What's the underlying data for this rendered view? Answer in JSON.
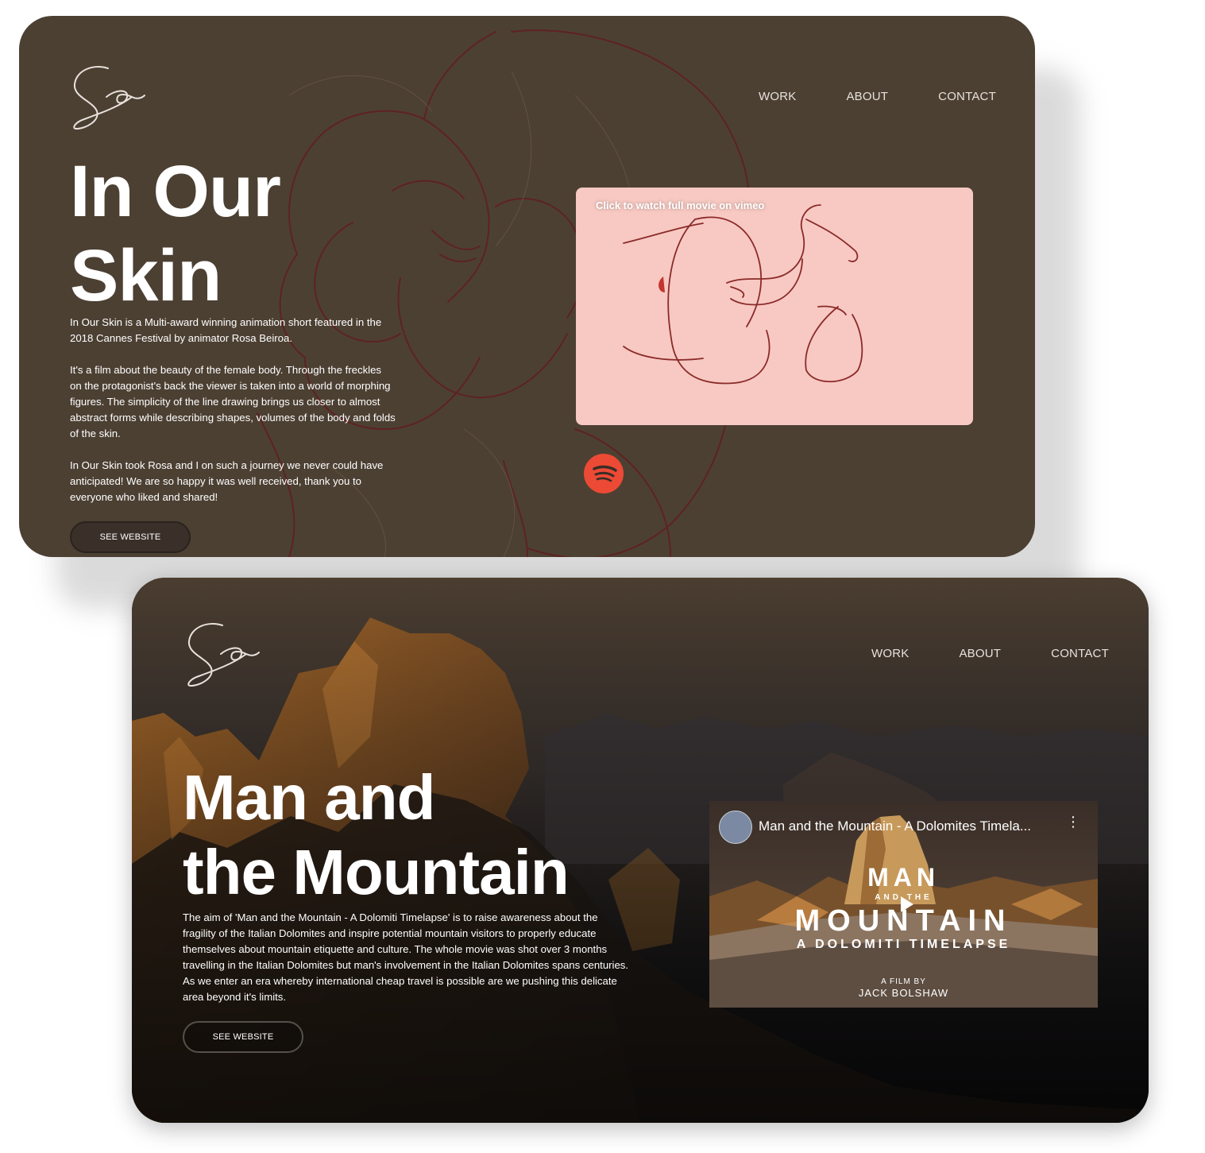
{
  "nav": {
    "work": "WORK",
    "about": "ABOUT",
    "contact": "CONTACT"
  },
  "project1": {
    "title_line1": "In Our",
    "title_line2": "Skin",
    "paragraphs": [
      "In Our Skin is a Multi-award winning animation short featured in the 2018 Cannes Festival by animator Rosa Beiroa.",
      "It's a film about the beauty of the female body. Through the freckles on the protagonist's back the viewer is taken into a world of morphing figures. The simplicity of the line drawing brings us closer to almost abstract forms while describing shapes, volumes of the body and folds of the skin.",
      "In Our Skin took Rosa and I on such a journey we never could have anticipated! We are so happy it was well received, thank you to everyone who liked and shared!"
    ],
    "button": "SEE WEBSITE",
    "video_caption": "Click to watch full movie on vimeo"
  },
  "project2": {
    "title_line1": "Man and",
    "title_line2": "the Mountain",
    "paragraph": "The aim of 'Man and the Mountain - A Dolomiti Timelapse' is to raise awareness about the fragility of the Italian Dolomites and inspire potential mountain visitors to properly educate themselves about mountain etiquette and culture. The whole movie was shot over 3 months travelling in the Italian Dolomites but man's involvement in the Italian Dolomites spans centuries. As we enter an era whereby international cheap travel is possible are we pushing this delicate area beyond it's limits.",
    "button": "SEE WEBSITE",
    "video": {
      "title": "Man and the Mountain - A Dolomites Timela...",
      "thumb_man": "MAN",
      "thumb_and_the": "AND THE",
      "thumb_mountain": "MOUNTAIN",
      "thumb_subtitle": "A DOLOMITI TIMELAPSE",
      "thumb_film_by": "A FILM BY",
      "thumb_author": "JACK BOLSHAW"
    }
  },
  "icons": [
    "signature-logo-icon",
    "spotify-icon",
    "play-icon",
    "more-vertical-icon"
  ],
  "colors": {
    "card1_bg": "#4c4033",
    "line_art": "#5e2222",
    "vimeo_bg": "#f7c9c2",
    "spotify": "#ec4a35"
  }
}
